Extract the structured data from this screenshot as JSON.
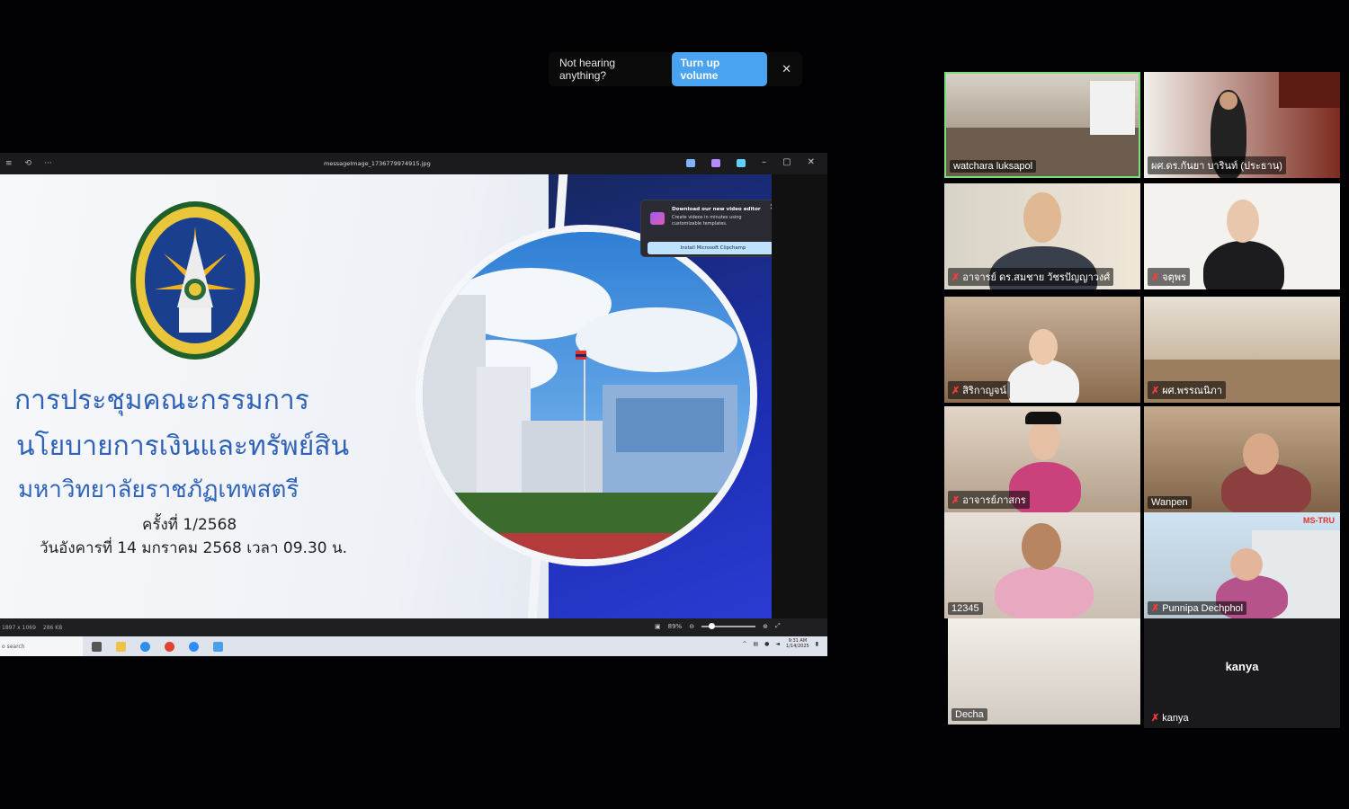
{
  "notice": {
    "text": "Not hearing anything?",
    "button": "Turn up volume",
    "close": "✕"
  },
  "viewer": {
    "filename": "messageImage_1736779974915.jpg",
    "window_controls": [
      "–",
      "▢",
      "✕"
    ],
    "image_info": "1897 x 1069",
    "file_size": "286 KB",
    "zoom": "89%"
  },
  "slide": {
    "title_line1": "การประชุมคณะกรรมการ",
    "title_line2": "นโยบายการเงินและทรัพย์สิน",
    "title_line3": "มหาวิทยาลัยราชภัฏเทพสตรี",
    "session": "ครั้งที่ 1/2568",
    "datetime": "วันอังคารที่ 14 มกราคม 2568 เวลา 09.30 น.",
    "seal_text_top": "มหาวิทยาลัยราชภัฏเทพสตรี",
    "seal_text_bottom": "THEPSATRI RAJABHAT UNIVERSITY"
  },
  "popup": {
    "title": "Download our new video editor",
    "desc": "Create videos in minutes using customizable templates.",
    "button": "Install Microsoft Clipchamp",
    "close": "✕"
  },
  "taskbar": {
    "search": "o search",
    "time": "9:31 AM",
    "date": "1/14/2025"
  },
  "participants": [
    {
      "name": "watchara luksapol",
      "muted": false,
      "active": true
    },
    {
      "name": "ผศ.ดร.กันยา บารินท์ (ประธาน)",
      "muted": false
    },
    {
      "name": "อาจารย์ ดร.สมชาย  วัชรปัญญาวงศ์",
      "muted": true
    },
    {
      "name": "จตุพร",
      "muted": true
    },
    {
      "name": "สิริกาญจน์",
      "muted": true
    },
    {
      "name": "ผศ.พรรณนิภา",
      "muted": true
    },
    {
      "name": "อาจารย์ภาสกร",
      "muted": true
    },
    {
      "name": "Wanpen",
      "muted": false
    },
    {
      "name": "12345",
      "muted": false
    },
    {
      "name": "Punnipa Dechphol",
      "muted": true
    },
    {
      "name": "Decha",
      "muted": false
    },
    {
      "name": "kanya",
      "muted": true,
      "center_label": "kanya"
    }
  ],
  "tile_labels": {
    "ms_tru": "MS-TRU"
  },
  "colors": {
    "accent_blue": "#2e62b9",
    "zoom_button": "#4aa3f0",
    "active_border": "#7ddc7d",
    "mute_red": "#ff3b3b"
  }
}
